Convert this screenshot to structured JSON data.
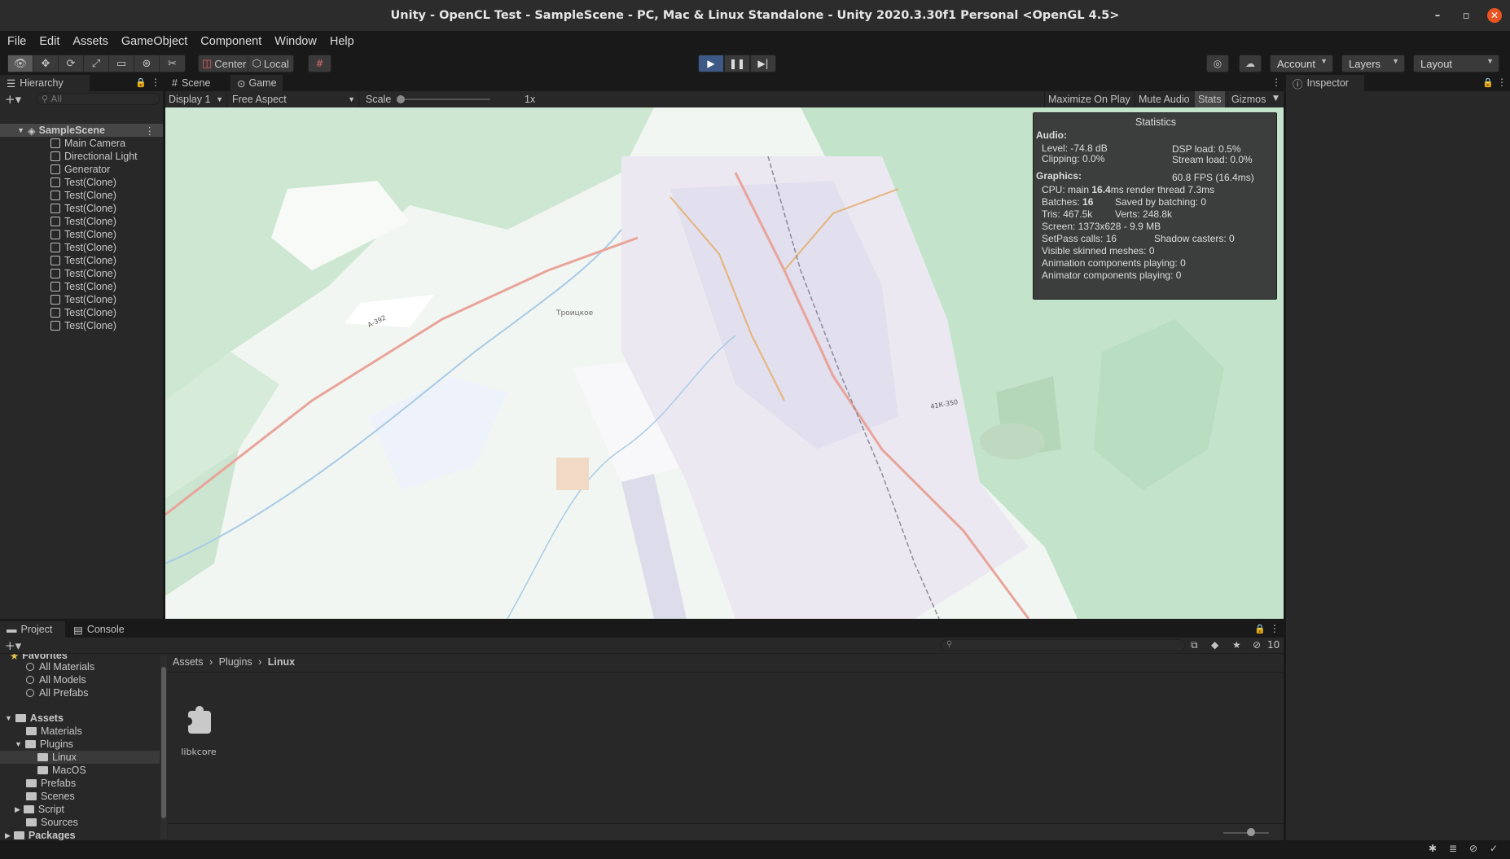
{
  "window": {
    "title": "Unity - OpenCL Test - SampleScene - PC, Mac & Linux Standalone - Unity 2020.3.30f1 Personal <OpenGL 4.5>"
  },
  "menu": [
    "File",
    "Edit",
    "Assets",
    "GameObject",
    "Component",
    "Window",
    "Help"
  ],
  "toolbar": {
    "pivot_center": "Center",
    "pivot_local": "Local",
    "account": "Account",
    "layers": "Layers",
    "layout": "Layout"
  },
  "hierarchy": {
    "tab": "Hierarchy",
    "search_placeholder": "All",
    "scene": "SampleScene",
    "items": [
      "Main Camera",
      "Directional Light",
      "Generator",
      "Test(Clone)",
      "Test(Clone)",
      "Test(Clone)",
      "Test(Clone)",
      "Test(Clone)",
      "Test(Clone)",
      "Test(Clone)",
      "Test(Clone)",
      "Test(Clone)",
      "Test(Clone)",
      "Test(Clone)",
      "Test(Clone)"
    ]
  },
  "views": {
    "tab_scene": "Scene",
    "tab_game": "Game",
    "display": "Display 1",
    "aspect": "Free Aspect",
    "scale_label": "Scale",
    "scale_value": "1x",
    "maximize": "Maximize On Play",
    "mute": "Mute Audio",
    "stats": "Stats",
    "gizmos": "Gizmos"
  },
  "map_labels": {
    "troitskoe": "Троицкое",
    "a392": "А-392",
    "r_label": "41К-350"
  },
  "statistics": {
    "title": "Statistics",
    "audio_header": "Audio:",
    "level": "Level: -74.8 dB",
    "clipping": "Clipping: 0.0%",
    "dsp": "DSP load: 0.5%",
    "stream": "Stream load: 0.0%",
    "graphics_header": "Graphics:",
    "fps": "60.8 FPS (16.4ms)",
    "cpu_prefix": "CPU: main ",
    "cpu_main": "16.4",
    "cpu_suffix": "ms  render thread 7.3ms",
    "batches_prefix": "Batches: ",
    "batches": "16",
    "saved": "Saved by batching: 0",
    "tris": "Tris: 467.5k",
    "verts": "Verts: 248.8k",
    "screen": "Screen: 1373x628 - 9.9 MB",
    "setpass": "SetPass calls: 16",
    "shadow": "Shadow casters: 0",
    "skinned": "Visible skinned meshes: 0",
    "anim": "Animation components playing: 0",
    "animator": "Animator components playing: 0"
  },
  "inspector": {
    "tab": "Inspector"
  },
  "project": {
    "tab_project": "Project",
    "tab_console": "Console",
    "favorites": "Favorites",
    "fav_items": [
      "All Materials",
      "All Models",
      "All Prefabs"
    ],
    "assets": "Assets",
    "tree": [
      "Materials",
      "Plugins",
      "Linux",
      "MacOS",
      "Prefabs",
      "Scenes",
      "Script",
      "Sources"
    ],
    "packages": "Packages",
    "breadcrumb": [
      "Assets",
      "Plugins",
      "Linux"
    ],
    "file_label": "libkcore",
    "hidden_count": "10"
  },
  "colors": {
    "accent_play": "#3d5a86",
    "close": "#e95420",
    "selection": "#2c5d87"
  }
}
